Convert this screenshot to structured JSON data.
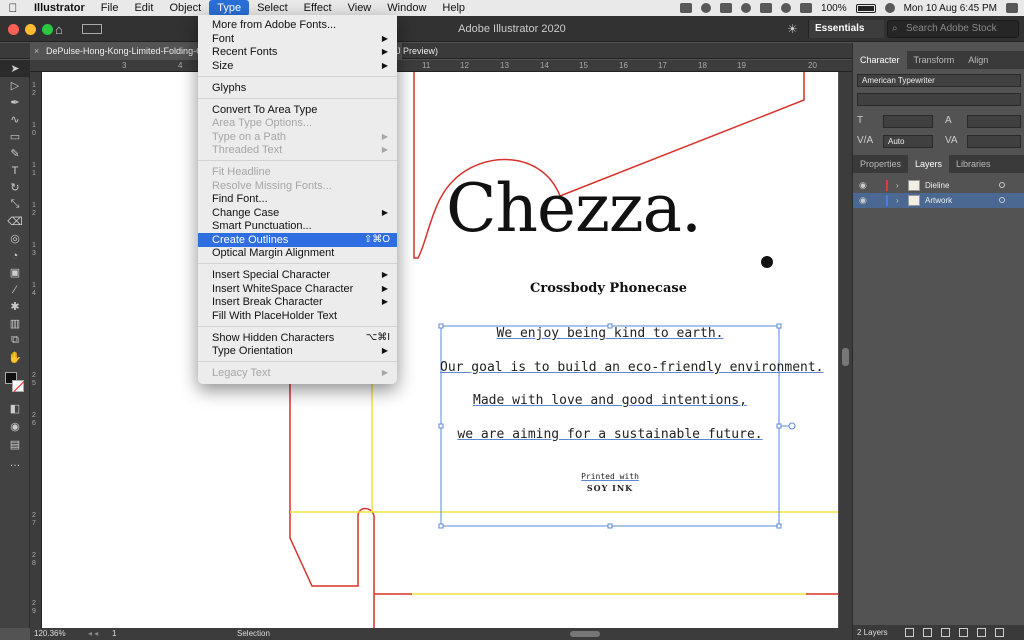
{
  "menubar": {
    "apple": "",
    "items": [
      "Illustrator",
      "File",
      "Edit",
      "Object",
      "Type",
      "Select",
      "Effect",
      "View",
      "Window",
      "Help"
    ],
    "battery": "100%",
    "clock": "Mon 10 Aug  6:45 PM"
  },
  "appbar": {
    "title": "Adobe Illustrator 2020",
    "workspace": "Essentials",
    "search_placeholder": "Search Adobe Stock"
  },
  "document": {
    "tab_label": "DePulse-Hong-Kong-Limited-Folding-C",
    "tab_suffix": "J Preview)",
    "close": "×"
  },
  "ruler": {
    "top": [
      "3",
      "4",
      "11",
      "12",
      "13",
      "14",
      "15",
      "16",
      "17",
      "18",
      "19",
      "20"
    ],
    "left": [
      "1",
      "2",
      "1",
      "0",
      "1",
      "1",
      "1",
      "2",
      "1",
      "3",
      "1",
      "4",
      "2",
      "5",
      "2",
      "6",
      "2",
      "7",
      "2",
      "8",
      "2",
      "9"
    ]
  },
  "artwork": {
    "brand": "Chezza.",
    "subtitle": "Crossbody Phonecase",
    "lines": [
      "We enjoy being kind to earth.",
      "Our goal is to build an eco-friendly environment.",
      "Made with love and good intentions,",
      "we are aiming for a sustainable future."
    ],
    "printed": "Printed with",
    "soy": "SOY INK"
  },
  "type_menu": {
    "items": [
      {
        "label": "More from Adobe Fonts...",
        "enabled": true
      },
      {
        "label": "Font",
        "enabled": true,
        "submenu": true
      },
      {
        "label": "Recent Fonts",
        "enabled": true,
        "submenu": true
      },
      {
        "label": "Size",
        "enabled": true,
        "submenu": true
      },
      {
        "label": "Glyphs",
        "enabled": true
      },
      {
        "label": "Convert To Area Type",
        "enabled": true
      },
      {
        "label": "Area Type Options...",
        "enabled": false
      },
      {
        "label": "Type on a Path",
        "enabled": false,
        "submenu": true
      },
      {
        "label": "Threaded Text",
        "enabled": false,
        "submenu": true
      },
      {
        "label": "Fit Headline",
        "enabled": false
      },
      {
        "label": "Resolve Missing Fonts...",
        "enabled": false
      },
      {
        "label": "Find Font...",
        "enabled": true
      },
      {
        "label": "Change Case",
        "enabled": true,
        "submenu": true
      },
      {
        "label": "Smart Punctuation...",
        "enabled": true
      },
      {
        "label": "Create Outlines",
        "enabled": true,
        "highlighted": true,
        "shortcut": "⇧⌘O"
      },
      {
        "label": "Optical Margin Alignment",
        "enabled": true
      },
      {
        "label": "Insert Special Character",
        "enabled": true,
        "submenu": true
      },
      {
        "label": "Insert WhiteSpace Character",
        "enabled": true,
        "submenu": true
      },
      {
        "label": "Insert Break Character",
        "enabled": true,
        "submenu": true
      },
      {
        "label": "Fill With PlaceHolder Text",
        "enabled": true
      },
      {
        "label": "Show Hidden Characters",
        "enabled": true,
        "shortcut": "⌥⌘I"
      },
      {
        "label": "Type Orientation",
        "enabled": true,
        "submenu": true
      },
      {
        "label": "Legacy Text",
        "enabled": false,
        "submenu": true
      }
    ]
  },
  "panels": {
    "top_tabs": [
      "Character",
      "Transform",
      "Align"
    ],
    "font_name": "American Typewriter",
    "leading": "Auto",
    "bottom_tabs": [
      "Properties",
      "Layers",
      "Libraries"
    ],
    "layers": [
      {
        "name": "Dieline",
        "color": "#e03a3a",
        "selected": false
      },
      {
        "name": "Artwork",
        "color": "#4a7ee0",
        "selected": true
      }
    ],
    "layer_count": "2 Layers"
  },
  "status": {
    "zoom": "120.36%",
    "page": "1",
    "tool": "Selection"
  },
  "colors": {
    "accent": "#2f6ee0",
    "dieline_red": "#d7322a",
    "guide_yellow": "#f3e33a",
    "bbox_blue": "#5a87d6"
  }
}
